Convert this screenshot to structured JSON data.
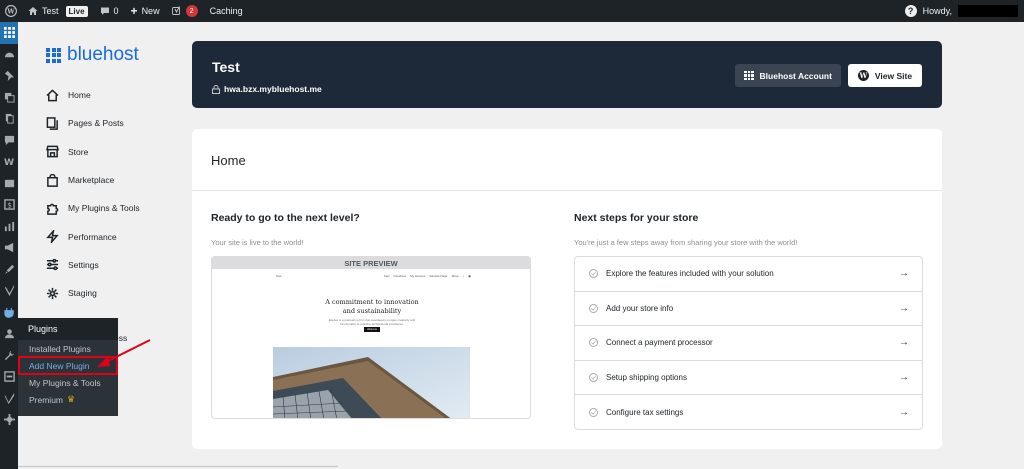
{
  "adminbar": {
    "site_name": "Test",
    "live_badge": "Live",
    "comments_count": "0",
    "new_label": "New",
    "yoast_count": "2",
    "caching_label": "Caching",
    "howdy": "Howdy,"
  },
  "admin_menu_icons": [
    "dashboard-icon",
    "bluehost-icon",
    "gauge-icon",
    "pin-icon",
    "media-icon",
    "pages-icon",
    "comments-icon",
    "woo-icon",
    "products-icon",
    "payments-icon",
    "analytics-icon",
    "marketing-icon",
    "appearance-icon",
    "yoast-icon",
    "plugins-icon",
    "users-icon",
    "tools-icon",
    "settings-icon",
    "yoast-seo-icon",
    "gear-icon"
  ],
  "flyout": {
    "title": "Plugins",
    "items": [
      "Installed Plugins",
      "Add New Plugin",
      "My Plugins & Tools",
      "Premium"
    ],
    "current": "Add New Plugin"
  },
  "bluehost": {
    "logo_text": "bluehost",
    "nav": [
      {
        "label": "Home",
        "icon": "home-icon"
      },
      {
        "label": "Pages & Posts",
        "icon": "pages-icon"
      },
      {
        "label": "Store",
        "icon": "store-icon"
      },
      {
        "label": "Marketplace",
        "icon": "bag-icon"
      },
      {
        "label": "My Plugins & Tools",
        "icon": "puzzle-icon"
      },
      {
        "label": "Performance",
        "icon": "bolt-icon"
      },
      {
        "label": "Settings",
        "icon": "sliders-icon"
      },
      {
        "label": "Staging",
        "icon": "staging-icon"
      }
    ],
    "partial_item": "rdPress"
  },
  "site": {
    "title": "Test",
    "url": "hwa.bzx.mybluehost.me",
    "account_button": "Bluehost Account",
    "view_button": "View Site"
  },
  "home": {
    "title": "Home",
    "left": {
      "title": "Ready to go to the next level?",
      "subtitle": "Your site is live to the world!",
      "preview_label": "SITE PREVIEW",
      "preview_nav_left": "Test",
      "preview_nav_items": [
        "Cart",
        "Checkout",
        "My account",
        "Sample Page",
        "Shop"
      ],
      "preview_headline_1": "A commitment to innovation",
      "preview_headline_2": "and sustainability",
      "preview_sub": "Études is a pioneering firm that seamlessly merges creativity and functionality to redefine architectural excellence.",
      "preview_button": "About us"
    },
    "right": {
      "title": "Next steps for your store",
      "subtitle": "You're just a few steps away from sharing your store with the world!",
      "steps": [
        "Explore the features included with your solution",
        "Add your store info",
        "Connect a payment processor",
        "Setup shipping options",
        "Configure tax settings"
      ]
    }
  },
  "colors": {
    "brand_blue": "#196bde",
    "dark_card": "#1d2838",
    "admin_bar": "#1d2327",
    "highlight_red": "#e0001a"
  }
}
